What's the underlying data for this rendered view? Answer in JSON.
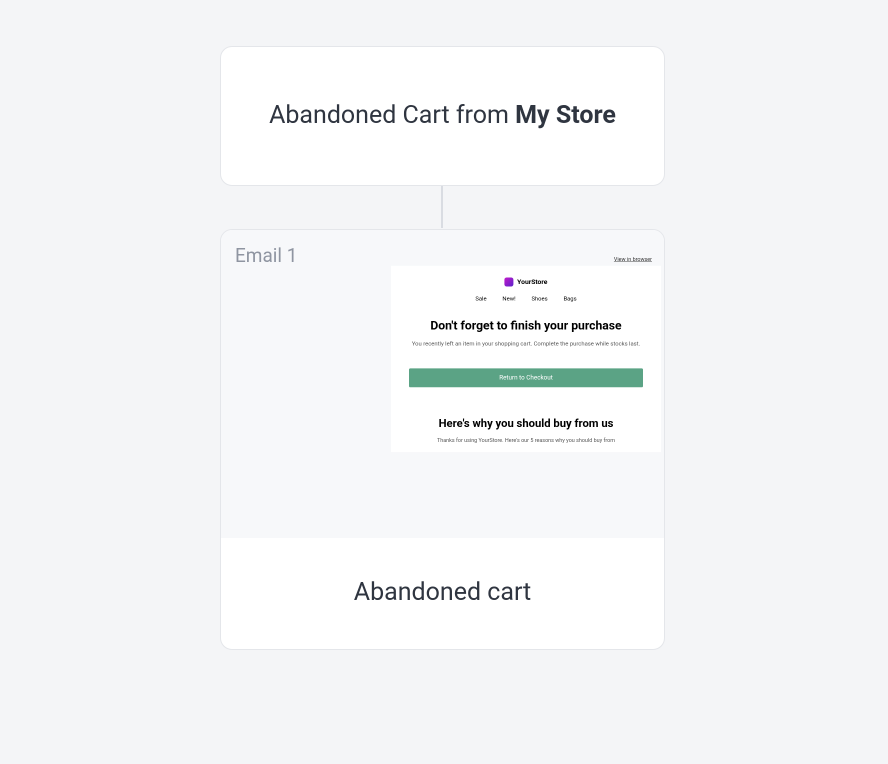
{
  "header": {
    "title_prefix": "Abandoned Cart from ",
    "title_bold": "My Store"
  },
  "email_card": {
    "badge": "Email 1",
    "footer_label": "Abandoned cart"
  },
  "email_preview": {
    "view_in_browser": "View in browser",
    "store_name": "YourStore",
    "nav": [
      "Sale",
      "New!",
      "Shoes",
      "Bags"
    ],
    "headline": "Don't forget to finish your purchase",
    "sub": "You recently left an item in your shopping cart. Complete the purchase while stocks last.",
    "cta": "Return to Checkout",
    "headline2": "Here's why you should buy from us",
    "sub2": "Thanks for using YourStore. Here's our 5 reasons why you should buy from"
  }
}
